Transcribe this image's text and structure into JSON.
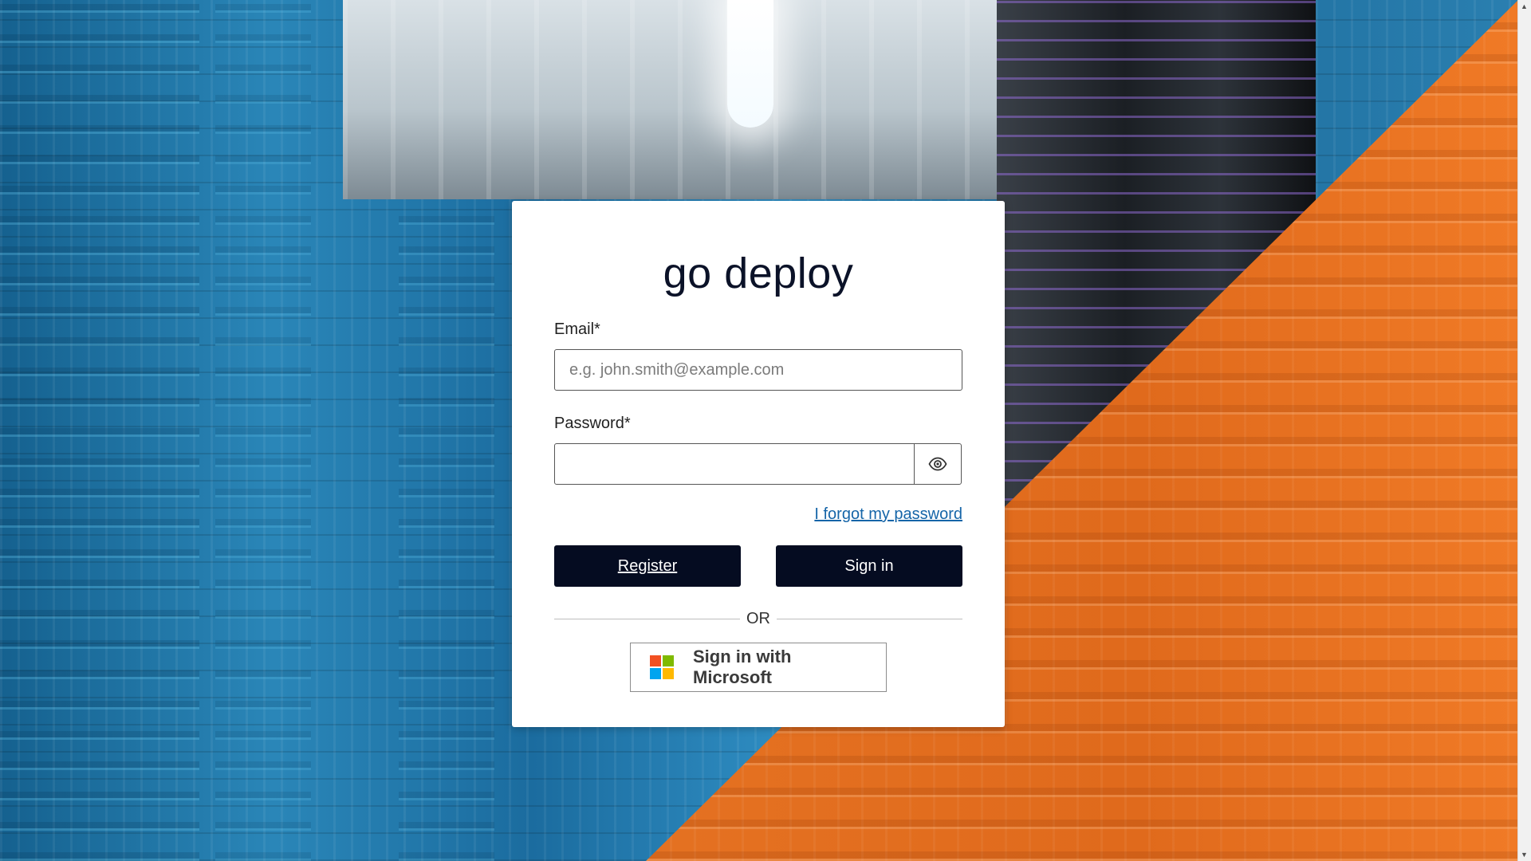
{
  "app": {
    "title": "go deploy"
  },
  "form": {
    "email_label": "Email*",
    "email_placeholder": "e.g. john.smith@example.com",
    "email_value": "",
    "password_label": "Password*",
    "password_value": "",
    "show_password_icon": "eye-icon",
    "forgot_link": "I forgot my password",
    "register_label": "Register",
    "signin_label": "Sign in",
    "divider_text": "OR",
    "microsoft_label": "Sign in with Microsoft",
    "microsoft_icon": "microsoft-logo-icon"
  },
  "colors": {
    "primary_button": "#050c21",
    "link": "#1565a8",
    "background_blue": "#1e6c9c",
    "background_orange": "#e57222",
    "microsoft_red": "#f25022",
    "microsoft_green": "#7fba00",
    "microsoft_blue": "#00a4ef",
    "microsoft_yellow": "#ffb900"
  }
}
